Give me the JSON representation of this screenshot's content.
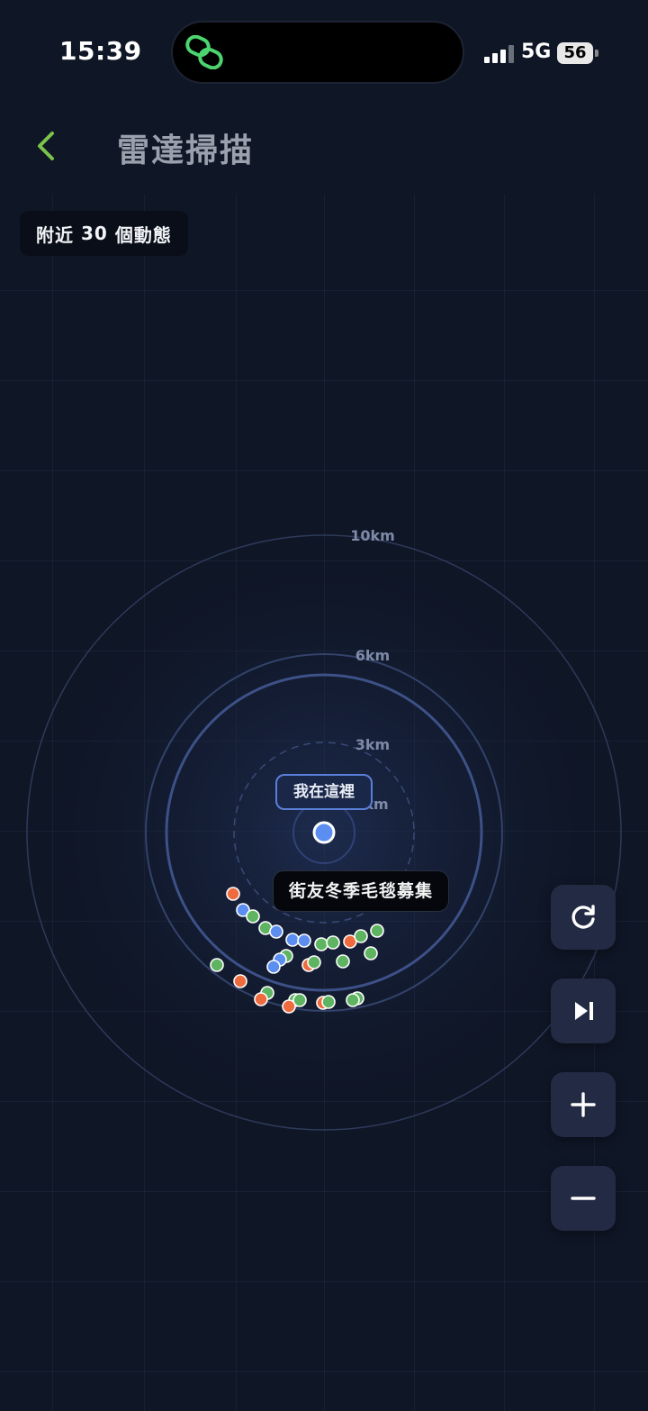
{
  "status_bar": {
    "time": "15:39",
    "network": "5G",
    "battery": "56"
  },
  "header": {
    "title": "雷達掃描",
    "back_icon": "chevron-left-icon"
  },
  "badge": {
    "prefix": "附近",
    "count": "30",
    "suffix": "個動態"
  },
  "radar": {
    "rings": [
      "10km",
      "6km",
      "3km",
      "km"
    ],
    "me_label": "我在這裡",
    "tooltip": "街友冬季毛毯募集"
  },
  "controls": [
    {
      "name": "refresh-button",
      "icon": "refresh-icon"
    },
    {
      "name": "skip-next-button",
      "icon": "skip-next-icon"
    },
    {
      "name": "zoom-in-button",
      "icon": "plus-icon"
    },
    {
      "name": "zoom-out-button",
      "icon": "minus-icon"
    }
  ],
  "colors": {
    "background": "#0f1626",
    "accent_green": "#7cc34a",
    "dot_green": "#5fb462",
    "dot_orange": "#ee6b3f",
    "dot_blue": "#5b8ef0"
  }
}
